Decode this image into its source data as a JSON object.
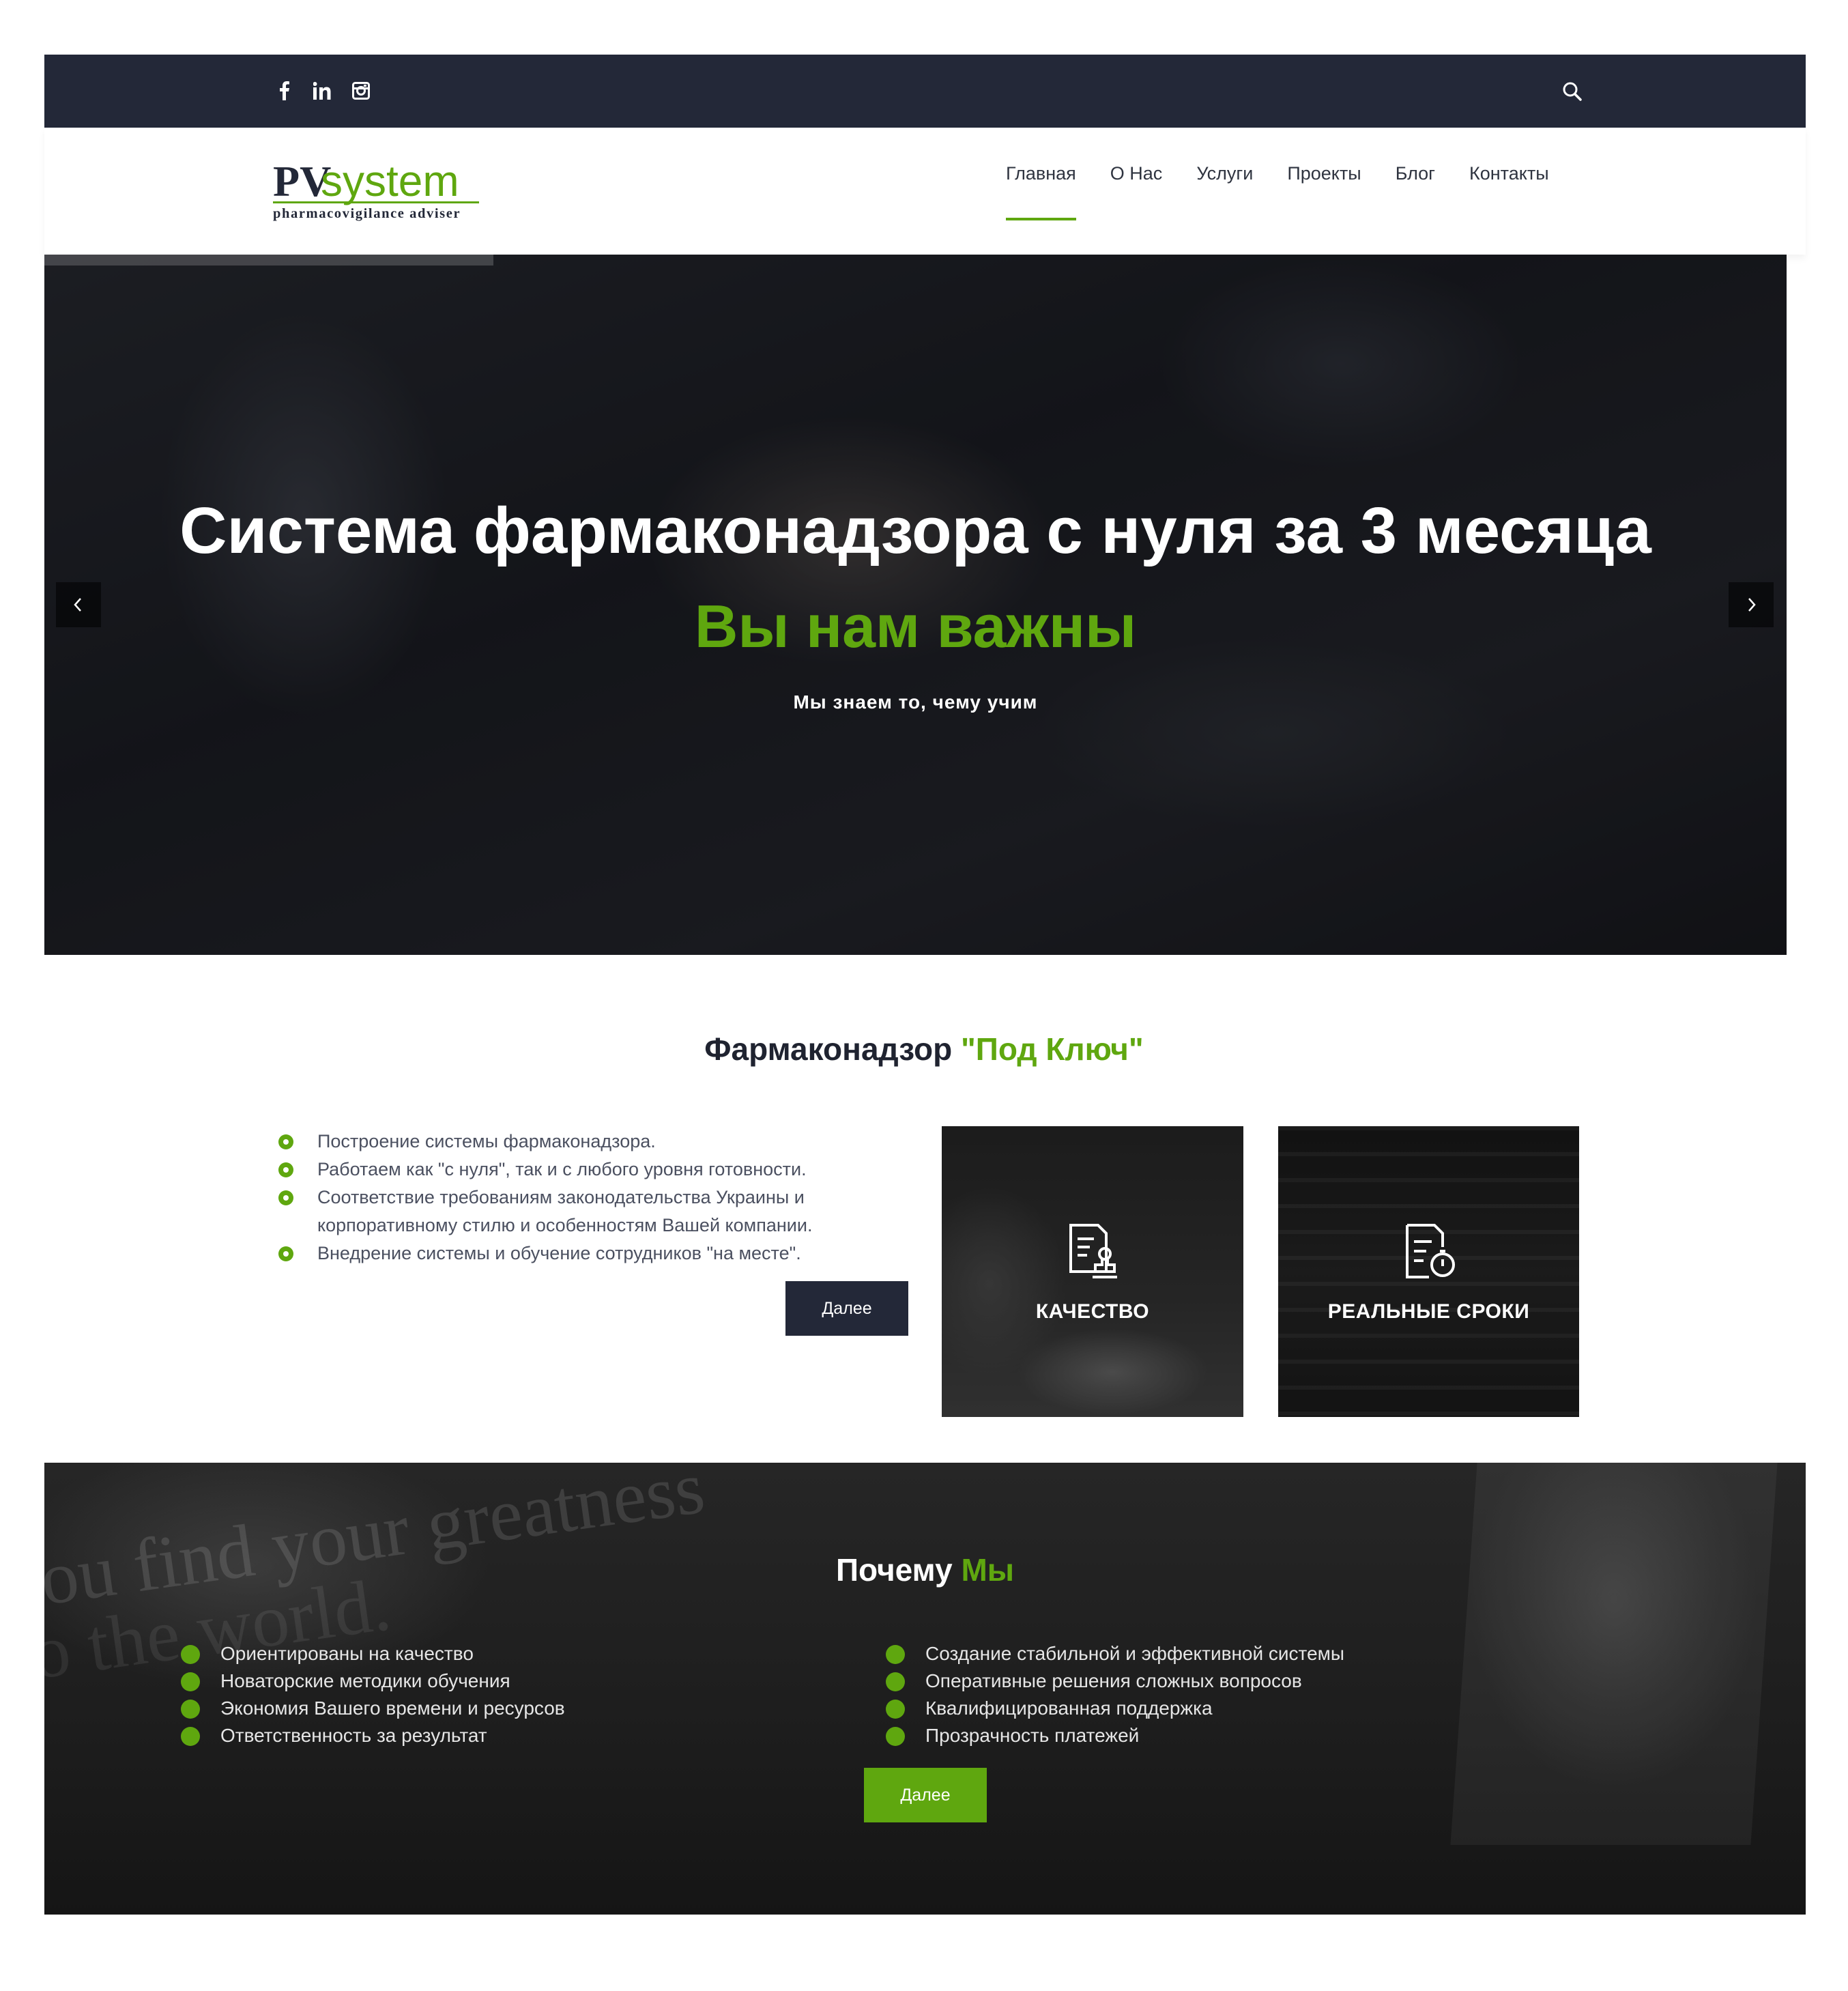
{
  "topbar": {
    "social": [
      {
        "name": "facebook-icon",
        "glyph": "f"
      },
      {
        "name": "linkedin-icon",
        "glyph": "in"
      },
      {
        "name": "instagram-icon",
        "glyph": ""
      }
    ],
    "search_icon": "search-icon"
  },
  "header": {
    "logo": {
      "main_a": "PV",
      "main_b": "system",
      "tagline": "pharmacovigilance adviser"
    },
    "nav": [
      "Главная",
      "О Нас",
      "Услуги",
      "Проекты",
      "Блог",
      "Контакты"
    ],
    "active_index": 0
  },
  "hero": {
    "title": "Система фармаконадзора с нуля за 3 месяца",
    "subtitle": "Вы нам важны",
    "tagline": "Мы знаем то, чему учим"
  },
  "turnkey": {
    "title_a": "Фармаконадзор ",
    "title_b": "\"Под Ключ\"",
    "bullets": [
      "Построение системы фармаконадзора.",
      "Работаем как \"с нуля\", так и с любого уровня готовности.",
      "Соответствие требованиям законодательства Украины и корпоративному стилю и особенностям Вашей компании.",
      "Внедрение системы и обучение сотрудников \"на месте\"."
    ],
    "button": "Далее",
    "cards": [
      {
        "label": "КАЧЕСТВО",
        "icon": "document-stamp-icon"
      },
      {
        "label": "РЕАЛЬНЫЕ СРОКИ",
        "icon": "document-timer-icon"
      }
    ]
  },
  "why": {
    "title_a": "Почему ",
    "title_b": "Мы",
    "left": [
      "Ориентированы на качество",
      "Новаторские методики обучения",
      "Экономия Вашего времени и ресурсов",
      "Ответственность за результат"
    ],
    "right": [
      "Создание стабильной и эффективной системы",
      "Оперативные решения сложных вопросов",
      "Квалифицированная поддержка",
      "Прозрачность платежей"
    ],
    "button": "Далее",
    "bg_text_1": "ou find your greatness",
    "bg_text_2": "o the world."
  },
  "colors": {
    "accent": "#5fa70f",
    "dark": "#232838"
  }
}
